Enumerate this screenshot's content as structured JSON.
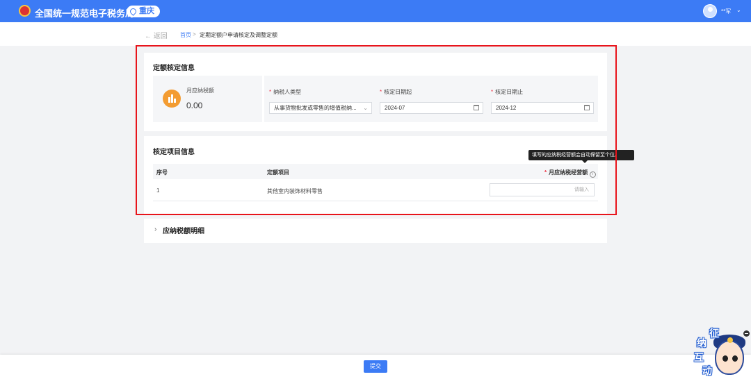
{
  "header": {
    "brand": "全国统一规范电子税务局",
    "region": "重庆",
    "user_name": "**军"
  },
  "breadcrumb": {
    "back_label": "返回",
    "home": "首页",
    "separator": ">",
    "current": "定期定额户申请核定及调整定额"
  },
  "quota_section": {
    "title": "定额核定信息",
    "monthly_tax_label": "月应纳税额",
    "monthly_tax_value": "0.00",
    "required_mark": "*",
    "taxpayer_type_label": "纳税人类型",
    "taxpayer_type_value": "从事货物批发或零售的增值税纳...",
    "start_label": "核定日期起",
    "start_value": "2024-07",
    "end_label": "核定日期止",
    "end_value": "2024-12"
  },
  "items_section": {
    "title": "核定项目信息",
    "columns": [
      "序号",
      "定额项目",
      "月应纳税经营额"
    ],
    "rows": [
      {
        "index": "1",
        "item": "其他室内装饰材料零售",
        "placeholder": "请输入"
      }
    ],
    "tooltip": "填写的应纳税经营额会自动保留至个位。"
  },
  "detail_section": {
    "title": "应纳税额明细"
  },
  "footer": {
    "submit_label": "提交"
  },
  "mascot": {
    "chars": [
      "征",
      "纳",
      "互",
      "动"
    ]
  },
  "colors": {
    "primary": "#3c7bf5",
    "highlight": "#e8141b",
    "required": "#e34",
    "stat_icon": "#f39c32"
  }
}
